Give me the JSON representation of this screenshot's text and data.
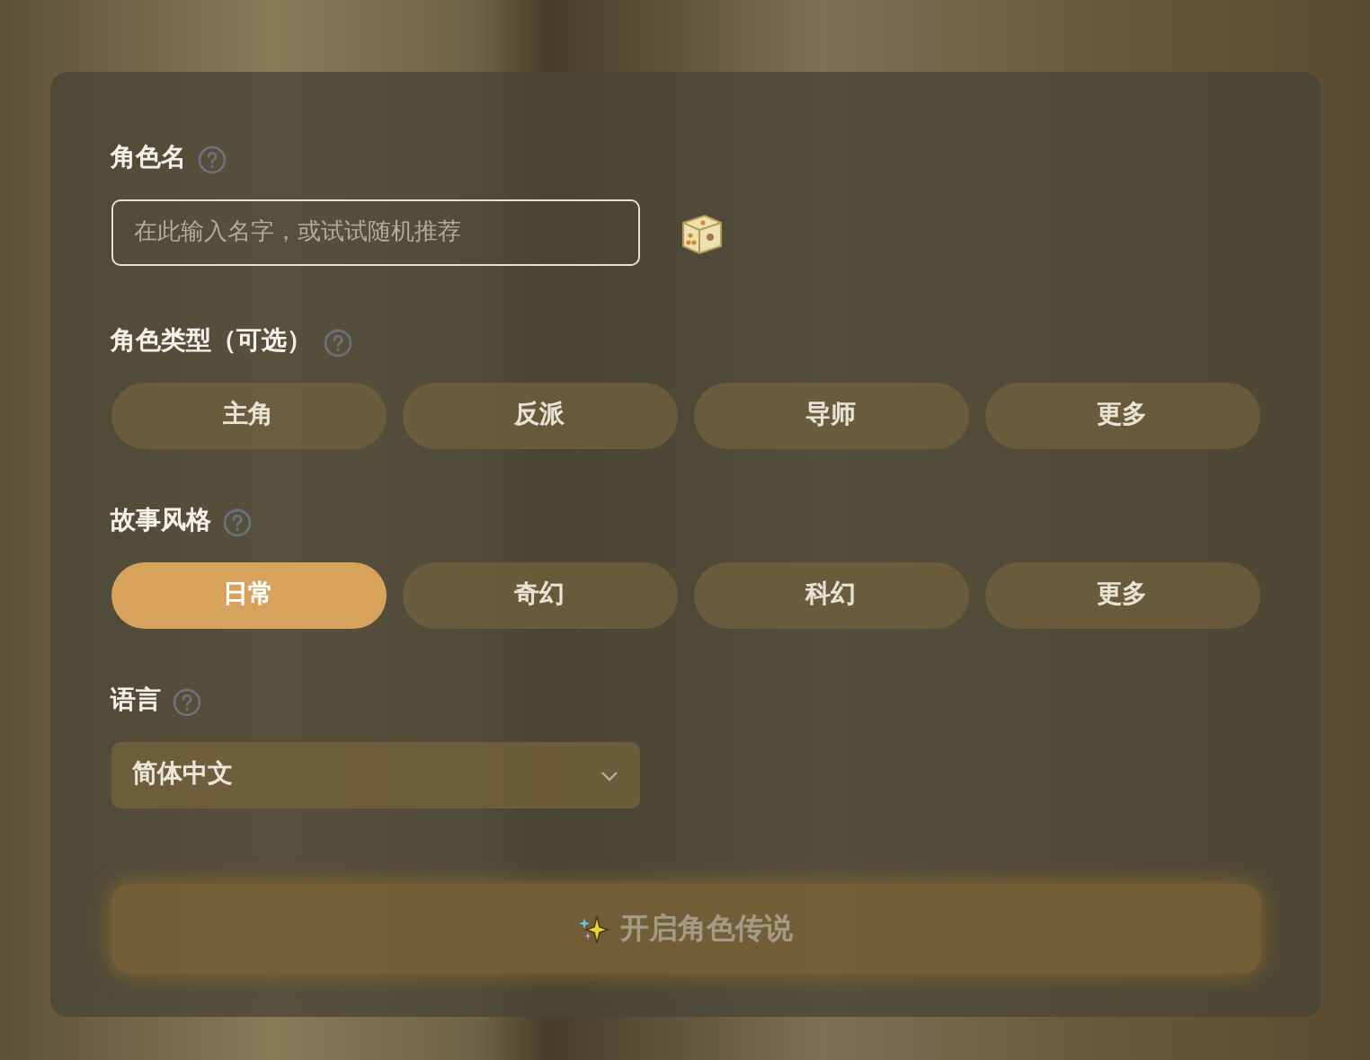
{
  "name_field": {
    "label": "角色名",
    "placeholder": "在此输入名字，或试试随机推荐"
  },
  "role_type": {
    "label": "角色类型（可选）",
    "options": [
      {
        "label": "主角",
        "selected": false
      },
      {
        "label": "反派",
        "selected": false
      },
      {
        "label": "导师",
        "selected": false
      },
      {
        "label": "更多",
        "selected": false
      }
    ]
  },
  "story_style": {
    "label": "故事风格",
    "options": [
      {
        "label": "日常",
        "selected": true
      },
      {
        "label": "奇幻",
        "selected": false
      },
      {
        "label": "科幻",
        "selected": false
      },
      {
        "label": "更多",
        "selected": false
      }
    ]
  },
  "language": {
    "label": "语言",
    "value": "简体中文"
  },
  "submit": {
    "label": "开启角色传说",
    "disabled": true
  }
}
